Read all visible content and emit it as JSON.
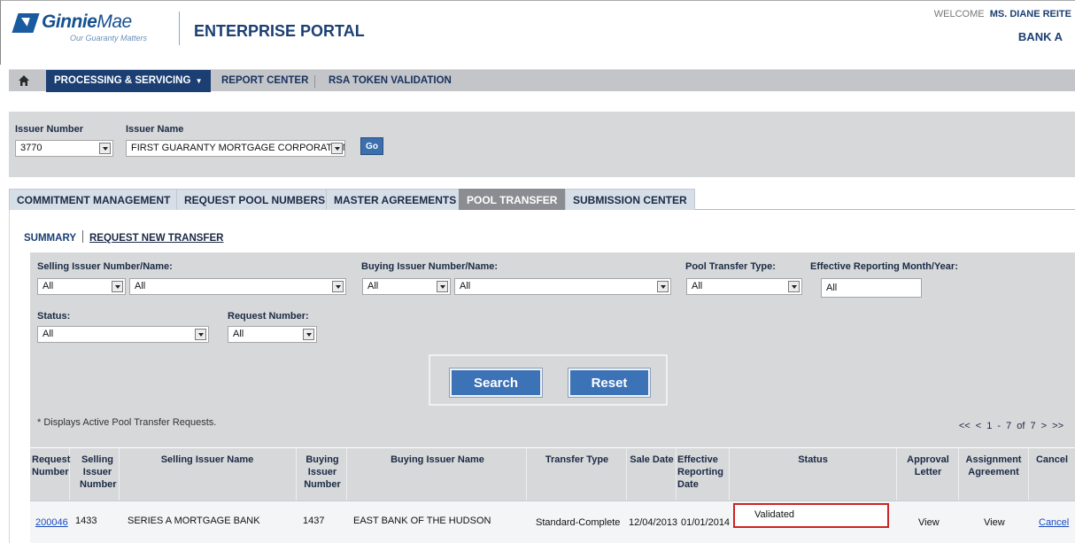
{
  "header": {
    "logo_name_bold": "Ginnie",
    "logo_name_rest": "Mae",
    "logo_tagline": "Our Guaranty Matters",
    "portal_title": "ENTERPRISE PORTAL",
    "welcome_prefix": "WELCOME",
    "user_name": "MS. DIANE REITE",
    "bank": "BANK A"
  },
  "nav": {
    "items": [
      {
        "label": "PROCESSING & SERVICING"
      },
      {
        "label": "REPORT CENTER"
      },
      {
        "label": "RSA TOKEN VALIDATION"
      }
    ]
  },
  "issuer": {
    "number_label": "Issuer Number",
    "number_value": "3770",
    "name_label": "Issuer Name",
    "name_value": "FIRST GUARANTY MORTGAGE CORPORATION",
    "go_label": "Go"
  },
  "tabs": [
    {
      "label": "COMMITMENT MANAGEMENT"
    },
    {
      "label": "REQUEST POOL NUMBERS"
    },
    {
      "label": "MASTER AGREEMENTS"
    },
    {
      "label": "POOL TRANSFER"
    },
    {
      "label": "SUBMISSION CENTER"
    }
  ],
  "subnav": {
    "summary": "SUMMARY",
    "request_new": "REQUEST NEW TRANSFER"
  },
  "filters": {
    "selling_label": "Selling Issuer Number/Name:",
    "selling_number": "All",
    "selling_name": "All",
    "buying_label": "Buying Issuer Number/Name:",
    "buying_number": "All",
    "buying_name": "All",
    "type_label": "Pool Transfer Type:",
    "type_value": "All",
    "effective_label": "Effective Reporting Month/Year:",
    "effective_value": "All",
    "status_label": "Status:",
    "status_value": "All",
    "request_label": "Request Number:",
    "request_value": "All"
  },
  "buttons": {
    "search": "Search",
    "reset": "Reset"
  },
  "note": "* Displays Active Pool Transfer Requests.",
  "pager": "<<  <  1 - 7 of 7  >  >>",
  "table": {
    "headers": {
      "request_number": "Request Number",
      "selling_issuer_number": "Selling Issuer Number",
      "selling_issuer_name": "Selling Issuer Name",
      "buying_issuer_number": "Buying Issuer Number",
      "buying_issuer_name": "Buying Issuer Name",
      "transfer_type": "Transfer Type",
      "sale_date": "Sale Date",
      "effective_date": "Effective Reporting Date",
      "status": "Status",
      "approval_letter": "Approval Letter",
      "assignment_agreement": "Assignment Agreement",
      "cancel": "Cancel"
    },
    "rows": [
      {
        "request_number": "200046",
        "selling_issuer_number": "1433",
        "selling_issuer_name": "SERIES A MORTGAGE BANK",
        "buying_issuer_number": "1437",
        "buying_issuer_name": "EAST BANK OF THE HUDSON",
        "transfer_type": "Standard-Complete",
        "sale_date": "12/04/2013",
        "effective_date": "01/01/2014",
        "status": "Validated",
        "approval_letter": "View",
        "assignment_agreement": "View",
        "cancel": "Cancel"
      }
    ]
  }
}
